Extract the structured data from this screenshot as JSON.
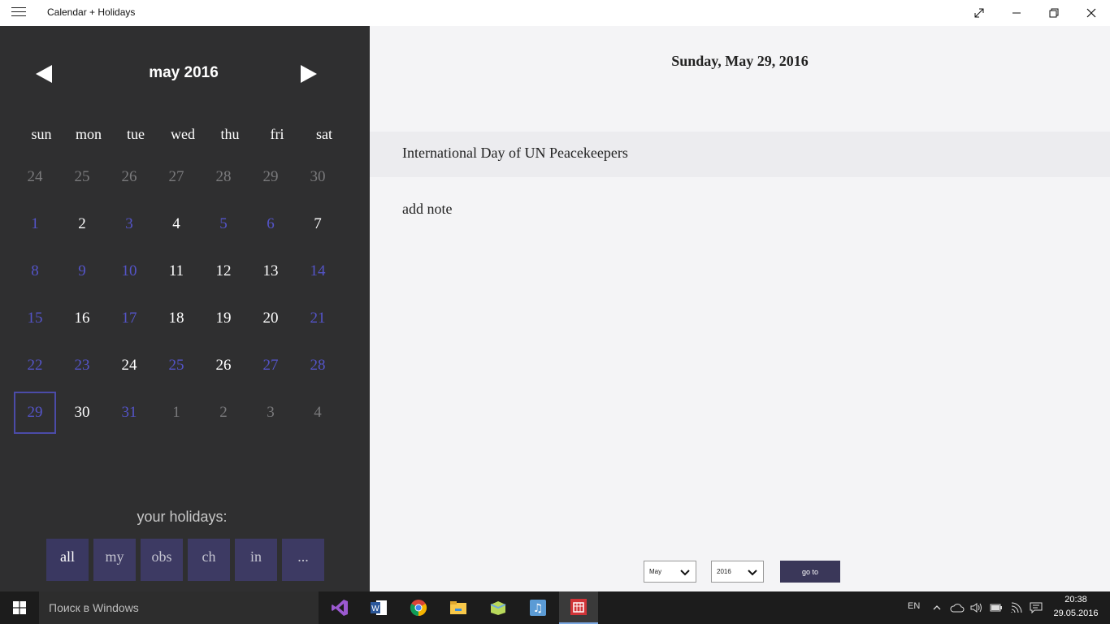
{
  "window": {
    "title": "Calendar + Holidays",
    "fullscreen_icon": "fullscreen-icon",
    "minimize_icon": "minimize-icon",
    "restore_icon": "restore-icon",
    "close_icon": "close-icon"
  },
  "calendar": {
    "month_title": "may 2016",
    "prev_icon": "triangle-left-icon",
    "next_icon": "triangle-right-icon",
    "weekdays": [
      "sun",
      "mon",
      "tue",
      "wed",
      "thu",
      "fri",
      "sat"
    ],
    "weeks": [
      [
        "24",
        "25",
        "26",
        "27",
        "28",
        "29",
        "30"
      ],
      [
        "1",
        "2",
        "3",
        "4",
        "5",
        "6",
        "7"
      ],
      [
        "8",
        "9",
        "10",
        "11",
        "12",
        "13",
        "14"
      ],
      [
        "15",
        "16",
        "17",
        "18",
        "19",
        "20",
        "21"
      ],
      [
        "22",
        "23",
        "24",
        "25",
        "26",
        "27",
        "28"
      ],
      [
        "29",
        "30",
        "31",
        "1",
        "2",
        "3",
        "4"
      ]
    ],
    "holiday_color": "#5454c8",
    "selected_day": "29"
  },
  "holidays_filter": {
    "label": "your holidays:",
    "buttons": [
      "all",
      "my",
      "obs",
      "ch",
      "in",
      "..."
    ],
    "accent": "#3d3a63"
  },
  "detail": {
    "date_heading": "Sunday, May 29, 2016",
    "holiday_name": "International Day of UN Peacekeepers",
    "add_note": "add note"
  },
  "navigator": {
    "month_value": "May",
    "year_value": "2016",
    "goto_label": "go to"
  },
  "taskbar": {
    "search_placeholder": "Поиск в Windows",
    "apps": [
      "visual-studio-icon",
      "word-icon",
      "chrome-icon",
      "file-explorer-icon",
      "folder-app-icon",
      "music-app-icon",
      "calendar-holidays-icon"
    ],
    "lang": "EN",
    "time": "20:38",
    "date": "29.05.2016"
  }
}
